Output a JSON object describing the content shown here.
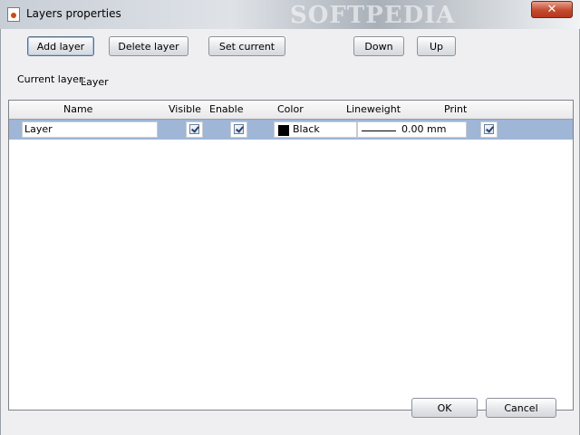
{
  "window": {
    "title": "Layers properties",
    "watermark": "SOFTPEDIA",
    "close_glyph": "✕"
  },
  "toolbar": {
    "add_layer": "Add layer",
    "delete_layer": "Delete layer",
    "set_current": "Set current",
    "down": "Down",
    "up": "Up"
  },
  "current_layer": {
    "label": "Current layer:",
    "value": "Layer"
  },
  "table": {
    "columns": [
      "Name",
      "Visible",
      "Enable",
      "Color",
      "Lineweight",
      "Print"
    ],
    "rows": [
      {
        "name": "Layer",
        "visible": true,
        "enable": true,
        "color_name": "Black",
        "color_hex": "#000000",
        "lineweight": "0.00 mm",
        "print": true
      }
    ]
  },
  "footer": {
    "ok": "OK",
    "cancel": "Cancel"
  },
  "icons": {
    "app": "java-app-icon",
    "close": "close-icon"
  }
}
